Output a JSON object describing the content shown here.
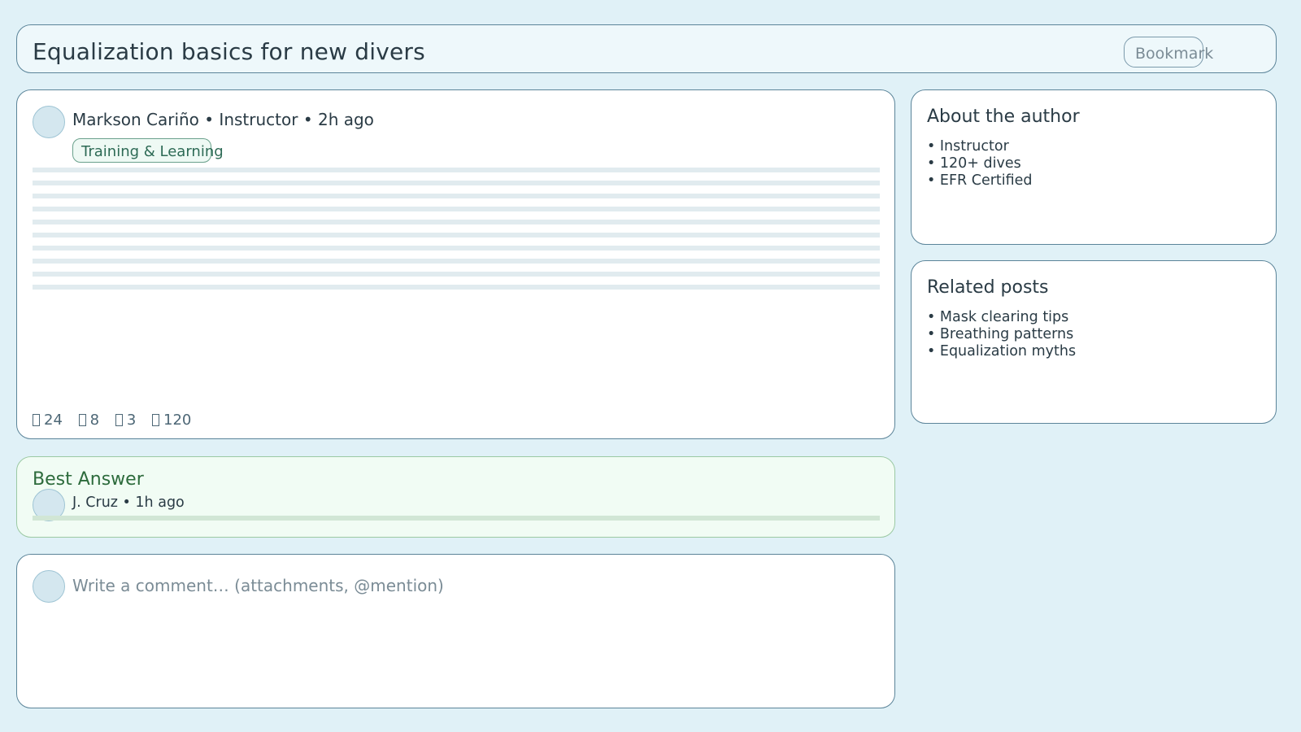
{
  "header": {
    "title": "Equalization basics for new divers",
    "bookmark_label": "Bookmark"
  },
  "post": {
    "meta": "Markson Cariño • Instructor • 2h ago",
    "tag": "Training & Learning",
    "stats": [
      {
        "icon": "like-icon",
        "value": "24"
      },
      {
        "icon": "comment-icon",
        "value": "8"
      },
      {
        "icon": "share-icon",
        "value": "3"
      },
      {
        "icon": "views-icon",
        "value": "120"
      }
    ]
  },
  "about": {
    "title": "About the author",
    "items": [
      "• Instructor",
      "• 120+ dives",
      "• EFR Certified"
    ]
  },
  "related": {
    "title": "Related posts",
    "items": [
      "• Mask clearing tips",
      "• Breathing patterns",
      "• Equalization myths"
    ]
  },
  "best_answer": {
    "title": "Best Answer",
    "meta": "J. Cruz • 1h ago"
  },
  "comment": {
    "placeholder": "Write a comment… (attachments, @mention)"
  },
  "colors": {
    "page_bg": "#e0f1f7",
    "border": "#5b8499",
    "tag_green": "#2d6a55",
    "answer_green": "#2d6b3c"
  }
}
